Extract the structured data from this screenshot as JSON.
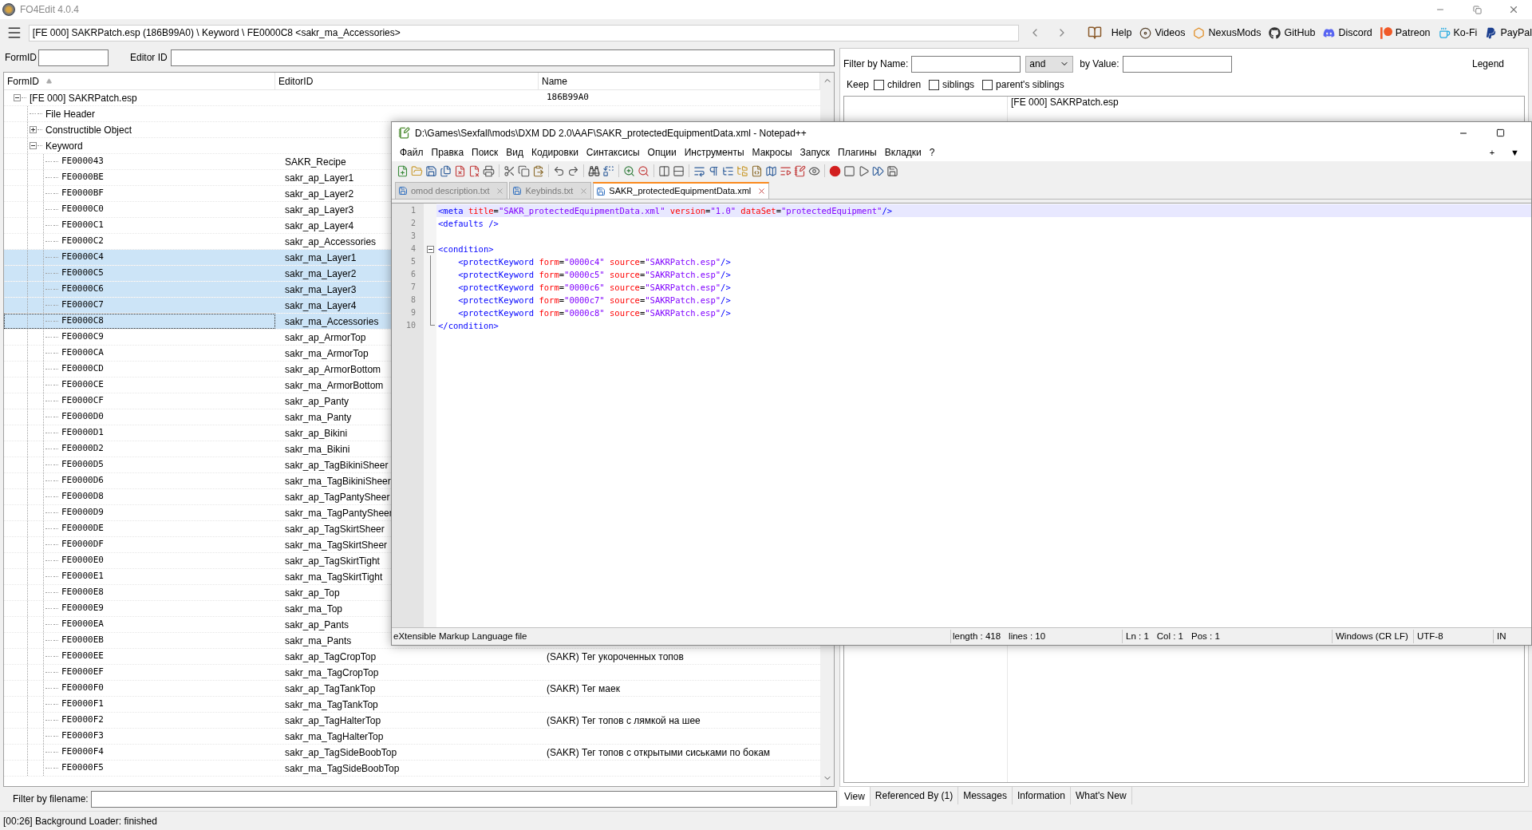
{
  "app": {
    "title": "FO4Edit 4.0.4"
  },
  "toolbar": {
    "path": "[FE 000] SAKRPatch.esp (186B99A0) \\ Keyword \\ FE0000C8 <sakr_ma_Accessories>",
    "links": [
      {
        "label": "Help",
        "kind": "book"
      },
      {
        "label": "Videos",
        "kind": "disc"
      },
      {
        "label": "NexusMods",
        "kind": "nexus"
      },
      {
        "label": "GitHub",
        "kind": "github"
      },
      {
        "label": "Discord",
        "kind": "discord"
      },
      {
        "label": "Patreon",
        "kind": "patreon"
      },
      {
        "label": "Ko-Fi",
        "kind": "kofi"
      },
      {
        "label": "PayPal",
        "kind": "paypal"
      }
    ]
  },
  "search": {
    "formid_label": "FormID",
    "editorid_label": "Editor ID"
  },
  "tree": {
    "columns": [
      "FormID",
      "EditorID",
      "Name"
    ],
    "root": {
      "label": "[FE 000] SAKRPatch.esp",
      "name": "186B99A0",
      "expanded": true,
      "children": [
        {
          "label": "File Header",
          "kind": "leaf"
        },
        {
          "label": "Constructible Object",
          "kind": "group",
          "expanded": false
        },
        {
          "label": "Keyword",
          "kind": "group",
          "expanded": true,
          "records": [
            {
              "form_id": "FE000043",
              "editor_id": "SAKR_Recipe",
              "selected": false,
              "focused": false
            },
            {
              "form_id": "FE0000BE",
              "editor_id": "sakr_ap_Layer1",
              "selected": false,
              "focused": false
            },
            {
              "form_id": "FE0000BF",
              "editor_id": "sakr_ap_Layer2",
              "selected": false,
              "focused": false
            },
            {
              "form_id": "FE0000C0",
              "editor_id": "sakr_ap_Layer3",
              "selected": false,
              "focused": false
            },
            {
              "form_id": "FE0000C1",
              "editor_id": "sakr_ap_Layer4",
              "selected": false,
              "focused": false
            },
            {
              "form_id": "FE0000C2",
              "editor_id": "sakr_ap_Accessories",
              "selected": false,
              "focused": false
            },
            {
              "form_id": "FE0000C4",
              "editor_id": "sakr_ma_Layer1",
              "selected": true,
              "focused": false
            },
            {
              "form_id": "FE0000C5",
              "editor_id": "sakr_ma_Layer2",
              "selected": true,
              "focused": false
            },
            {
              "form_id": "FE0000C6",
              "editor_id": "sakr_ma_Layer3",
              "selected": true,
              "focused": false
            },
            {
              "form_id": "FE0000C7",
              "editor_id": "sakr_ma_Layer4",
              "selected": true,
              "focused": false
            },
            {
              "form_id": "FE0000C8",
              "editor_id": "sakr_ma_Accessories",
              "selected": true,
              "focused": true
            },
            {
              "form_id": "FE0000C9",
              "editor_id": "sakr_ap_ArmorTop",
              "selected": false,
              "focused": false
            },
            {
              "form_id": "FE0000CA",
              "editor_id": "sakr_ma_ArmorTop",
              "selected": false,
              "focused": false
            },
            {
              "form_id": "FE0000CD",
              "editor_id": "sakr_ap_ArmorBottom",
              "selected": false,
              "focused": false
            },
            {
              "form_id": "FE0000CE",
              "editor_id": "sakr_ma_ArmorBottom",
              "selected": false,
              "focused": false
            },
            {
              "form_id": "FE0000CF",
              "editor_id": "sakr_ap_Panty",
              "selected": false,
              "focused": false
            },
            {
              "form_id": "FE0000D0",
              "editor_id": "sakr_ma_Panty",
              "selected": false,
              "focused": false
            },
            {
              "form_id": "FE0000D1",
              "editor_id": "sakr_ap_Bikini",
              "selected": false,
              "focused": false
            },
            {
              "form_id": "FE0000D2",
              "editor_id": "sakr_ma_Bikini",
              "selected": false,
              "focused": false
            },
            {
              "form_id": "FE0000D5",
              "editor_id": "sakr_ap_TagBikiniSheer",
              "selected": false,
              "focused": false
            },
            {
              "form_id": "FE0000D6",
              "editor_id": "sakr_ma_TagBikiniSheer",
              "selected": false,
              "focused": false
            },
            {
              "form_id": "FE0000D8",
              "editor_id": "sakr_ap_TagPantySheer",
              "selected": false,
              "focused": false
            },
            {
              "form_id": "FE0000D9",
              "editor_id": "sakr_ma_TagPantySheer",
              "selected": false,
              "focused": false
            },
            {
              "form_id": "FE0000DE",
              "editor_id": "sakr_ap_TagSkirtSheer",
              "selected": false,
              "focused": false
            },
            {
              "form_id": "FE0000DF",
              "editor_id": "sakr_ma_TagSkirtSheer",
              "selected": false,
              "focused": false
            },
            {
              "form_id": "FE0000E0",
              "editor_id": "sakr_ap_TagSkirtTight",
              "selected": false,
              "focused": false
            },
            {
              "form_id": "FE0000E1",
              "editor_id": "sakr_ma_TagSkirtTight",
              "selected": false,
              "focused": false
            },
            {
              "form_id": "FE0000E8",
              "editor_id": "sakr_ap_Top",
              "selected": false,
              "focused": false
            },
            {
              "form_id": "FE0000E9",
              "editor_id": "sakr_ma_Top",
              "selected": false,
              "focused": false
            },
            {
              "form_id": "FE0000EA",
              "editor_id": "sakr_ap_Pants",
              "selected": false,
              "focused": false
            },
            {
              "form_id": "FE0000EB",
              "editor_id": "sakr_ma_Pants",
              "selected": false,
              "focused": false
            },
            {
              "form_id": "FE0000EE",
              "editor_id": "sakr_ap_TagCropTop",
              "name": "(SAKR) Тег укороченных топов",
              "selected": false,
              "focused": false
            },
            {
              "form_id": "FE0000EF",
              "editor_id": "sakr_ma_TagCropTop",
              "selected": false,
              "focused": false
            },
            {
              "form_id": "FE0000F0",
              "editor_id": "sakr_ap_TagTankTop",
              "name": "(SAKR) Тег маек",
              "selected": false,
              "focused": false
            },
            {
              "form_id": "FE0000F1",
              "editor_id": "sakr_ma_TagTankTop",
              "selected": false,
              "focused": false
            },
            {
              "form_id": "FE0000F2",
              "editor_id": "sakr_ap_TagHalterTop",
              "name": "(SAKR) Тег топов с лямкой на шее",
              "selected": false,
              "focused": false
            },
            {
              "form_id": "FE0000F3",
              "editor_id": "sakr_ma_TagHalterTop",
              "selected": false,
              "focused": false
            },
            {
              "form_id": "FE0000F4",
              "editor_id": "sakr_ap_TagSideBoobTop",
              "name": "(SAKR) Тег топов с открытыми сиськами по бокам",
              "selected": false,
              "focused": false
            },
            {
              "form_id": "FE0000F5",
              "editor_id": "sakr_ma_TagSideBoobTop",
              "selected": false,
              "focused": false
            }
          ]
        }
      ]
    }
  },
  "file_filter": {
    "label": "Filter by filename:"
  },
  "filter": {
    "name_label": "Filter by Name:",
    "operator": "and",
    "value_label": "by Value:",
    "legend": "Legend",
    "keep_label": "Keep",
    "checks": [
      {
        "label": "children",
        "checked": false
      },
      {
        "label": "siblings",
        "checked": false
      },
      {
        "label": "parent's siblings",
        "checked": false
      }
    ]
  },
  "view": {
    "header": "[FE 000] SAKRPatch.esp",
    "tabs": [
      {
        "label": "View",
        "selected": true
      },
      {
        "label": "Referenced By (1)",
        "selected": false
      },
      {
        "label": "Messages",
        "selected": false
      },
      {
        "label": "Information",
        "selected": false
      },
      {
        "label": "What's New",
        "selected": false
      }
    ]
  },
  "status_bar": "[00:26] Background Loader: finished",
  "notepad": {
    "title": "D:\\Games\\Sexfall\\mods\\DXM DD 2.0\\AAF\\SAKR_protectedEquipmentData.xml - Notepad++",
    "menu": [
      "Файл",
      "Правка",
      "Поиск",
      "Вид",
      "Кодировки",
      "Синтаксисы",
      "Опции",
      "Инструменты",
      "Макросы",
      "Запуск",
      "Плагины",
      "Вкладки",
      "?"
    ],
    "menu_extras": [
      "+",
      "▼"
    ],
    "tabs": [
      {
        "label": "omod description.txt",
        "selected": false
      },
      {
        "label": "Keybinds.txt",
        "selected": false
      },
      {
        "label": "SAKR_protectedEquipmentData.xml",
        "selected": true
      }
    ],
    "lines": [
      {
        "number": "1",
        "text": "<meta title=\"SAKR_protectedEquipmentData.xml\" version=\"1.0\" dataSet=\"protectedEquipment\"/>",
        "current": true,
        "kind": "plain"
      },
      {
        "number": "2",
        "text": "<defaults />",
        "current": false,
        "kind": "plain"
      },
      {
        "number": "3",
        "current": false,
        "kind": "plain"
      },
      {
        "number": "4",
        "text": "<condition>",
        "current": false,
        "kind": "foldstart"
      },
      {
        "number": "5",
        "text": "    <protectKeyword form=\"0000c4\" source=\"SAKRPatch.esp\"/>",
        "current": false,
        "kind": "folded"
      },
      {
        "number": "6",
        "text": "    <protectKeyword form=\"0000c5\" source=\"SAKRPatch.esp\"/>",
        "current": false,
        "kind": "folded"
      },
      {
        "number": "7",
        "text": "    <protectKeyword form=\"0000c6\" source=\"SAKRPatch.esp\"/>",
        "current": false,
        "kind": "folded"
      },
      {
        "number": "8",
        "text": "    <protectKeyword form=\"0000c7\" source=\"SAKRPatch.esp\"/>",
        "current": false,
        "kind": "folded"
      },
      {
        "number": "9",
        "text": "    <protectKeyword form=\"0000c8\" source=\"SAKRPatch.esp\"/>",
        "current": false,
        "kind": "folded"
      },
      {
        "number": "10",
        "text": "</condition>",
        "current": false,
        "kind": "foldend"
      }
    ],
    "status": {
      "file_type": "eXtensible Markup Language file",
      "length": "length : 418",
      "lines": "lines : 10",
      "ln": "Ln : 1",
      "col": "Col : 1",
      "pos": "Pos : 1",
      "eol": "Windows (CR LF)",
      "encoding": "UTF-8",
      "mode": "IN"
    }
  }
}
